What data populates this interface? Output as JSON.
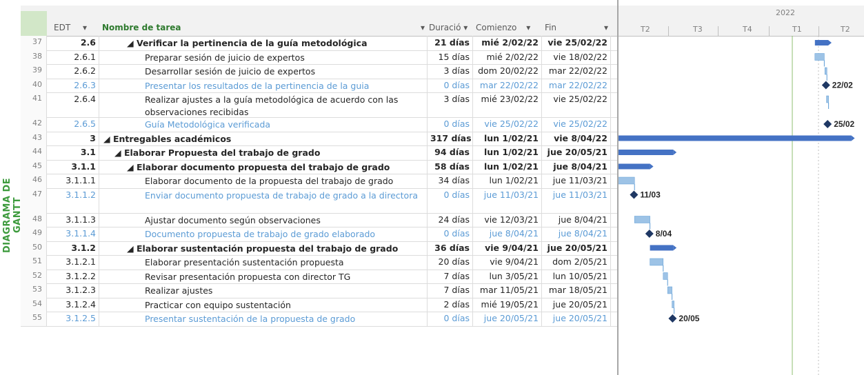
{
  "side_label": "DIAGRAMA DE GANTT",
  "columns": {
    "edt": "EDT",
    "task": "Nombre de tarea",
    "dur": "Duració",
    "start": "Comienzo",
    "finish": "Fin"
  },
  "timeline": {
    "year": "2022",
    "quarters": [
      "T2",
      "T3",
      "T4",
      "T1",
      "T2"
    ]
  },
  "rows": [
    {
      "n": "37",
      "edt": "2.6",
      "name": "◢ Verificar la pertinencia de la guía metodológica",
      "dur": "21 días",
      "start": "mié 2/02/22",
      "fin": "vie 25/02/22",
      "type": "summary",
      "indent": 1
    },
    {
      "n": "38",
      "edt": "2.6.1",
      "name": "Preparar sesión de juicio de expertos",
      "dur": "15 días",
      "start": "mié 2/02/22",
      "fin": "vie 18/02/22",
      "type": "task",
      "indent": 2
    },
    {
      "n": "39",
      "edt": "2.6.2",
      "name": "Desarrollar sesión de juicio de expertos",
      "dur": "3 días",
      "start": "dom 20/02/22",
      "fin": "mar 22/02/22",
      "type": "task",
      "indent": 2
    },
    {
      "n": "40",
      "edt": "2.6.3",
      "name": "Presentar los resultados de la pertinencia de la guia",
      "dur": "0 días",
      "start": "mar 22/02/22",
      "fin": "mar 22/02/22",
      "type": "milestone",
      "indent": 2
    },
    {
      "n": "41",
      "edt": "2.6.4",
      "name": "Realizar ajustes a la guía metodológica de acuerdo con las observaciones recibidas",
      "dur": "3 días",
      "start": "mié 23/02/22",
      "fin": "vie 25/02/22",
      "type": "task",
      "indent": 2
    },
    {
      "n": "42",
      "edt": "2.6.5",
      "name": "Guía Metodológica verificada",
      "dur": "0 días",
      "start": "vie 25/02/22",
      "fin": "vie 25/02/22",
      "type": "milestone",
      "indent": 2
    },
    {
      "n": "43",
      "edt": "3",
      "name": "◢ Entregables académicos",
      "dur": "317 días",
      "start": "lun 1/02/21",
      "fin": "vie 8/04/22",
      "type": "summary",
      "indent": 0
    },
    {
      "n": "44",
      "edt": "3.1",
      "name": "◢ Elaborar Propuesta del trabajo de grado",
      "dur": "94 días",
      "start": "lun 1/02/21",
      "fin": "jue 20/05/21",
      "type": "summary",
      "indent": 1
    },
    {
      "n": "45",
      "edt": "3.1.1",
      "name": "◢ Elaborar documento propuesta del trabajo de grado",
      "dur": "58 días",
      "start": "lun 1/02/21",
      "fin": "jue 8/04/21",
      "type": "summary",
      "indent": 1
    },
    {
      "n": "46",
      "edt": "3.1.1.1",
      "name": "Elaborar documento de la propuesta del trabajo de grado",
      "dur": "34 días",
      "start": "lun 1/02/21",
      "fin": "jue 11/03/21",
      "type": "task",
      "indent": 2
    },
    {
      "n": "47",
      "edt": "3.1.1.2",
      "name": "Enviar documento propuesta de trabajo de grado a la directora",
      "dur": "0 días",
      "start": "jue 11/03/21",
      "fin": "jue 11/03/21",
      "type": "milestone",
      "indent": 2
    },
    {
      "n": "48",
      "edt": "3.1.1.3",
      "name": "Ajustar documento según observaciones",
      "dur": "24 días",
      "start": "vie 12/03/21",
      "fin": "jue 8/04/21",
      "type": "task",
      "indent": 2
    },
    {
      "n": "49",
      "edt": "3.1.1.4",
      "name": "Documento propuesta de trabajo de grado elaborado",
      "dur": "0 días",
      "start": "jue 8/04/21",
      "fin": "jue 8/04/21",
      "type": "milestone",
      "indent": 2
    },
    {
      "n": "50",
      "edt": "3.1.2",
      "name": "◢ Elaborar sustentación propuesta del trabajo de grado",
      "dur": "36 días",
      "start": "vie 9/04/21",
      "fin": "jue 20/05/21",
      "type": "summary",
      "indent": 1
    },
    {
      "n": "51",
      "edt": "3.1.2.1",
      "name": "Elaborar presentación sustentación propuesta",
      "dur": "20 días",
      "start": "vie 9/04/21",
      "fin": "dom 2/05/21",
      "type": "task",
      "indent": 2
    },
    {
      "n": "52",
      "edt": "3.1.2.2",
      "name": "Revisar presentación propuesta con director TG",
      "dur": "7 días",
      "start": "lun 3/05/21",
      "fin": "lun 10/05/21",
      "type": "task",
      "indent": 2
    },
    {
      "n": "53",
      "edt": "3.1.2.3",
      "name": "Realizar ajustes",
      "dur": "7 días",
      "start": "mar 11/05/21",
      "fin": "mar 18/05/21",
      "type": "task",
      "indent": 2
    },
    {
      "n": "54",
      "edt": "3.1.2.4",
      "name": "Practicar con equipo sustentación",
      "dur": "2 días",
      "start": "mié 19/05/21",
      "fin": "jue 20/05/21",
      "type": "task",
      "indent": 2
    },
    {
      "n": "55",
      "edt": "3.1.2.5",
      "name": "Presentar sustentación de la propuesta de grado",
      "dur": "0 días",
      "start": "jue 20/05/21",
      "fin": "jue 20/05/21",
      "type": "milestone",
      "indent": 2
    }
  ],
  "milestone_labels": {
    "r40": "22/02",
    "r42": "25/02",
    "r47": "11/03",
    "r49": "8/04",
    "r55": "20/05"
  },
  "colors": {
    "summary_bar": "#4472c4",
    "task_bar": "#9dc3e6",
    "milestone": "#1f3864",
    "link": "#5b9bd5",
    "today_line": "#8fbf6f",
    "header_bg": "#f2f2f2",
    "corner": "#d2e7c8"
  }
}
